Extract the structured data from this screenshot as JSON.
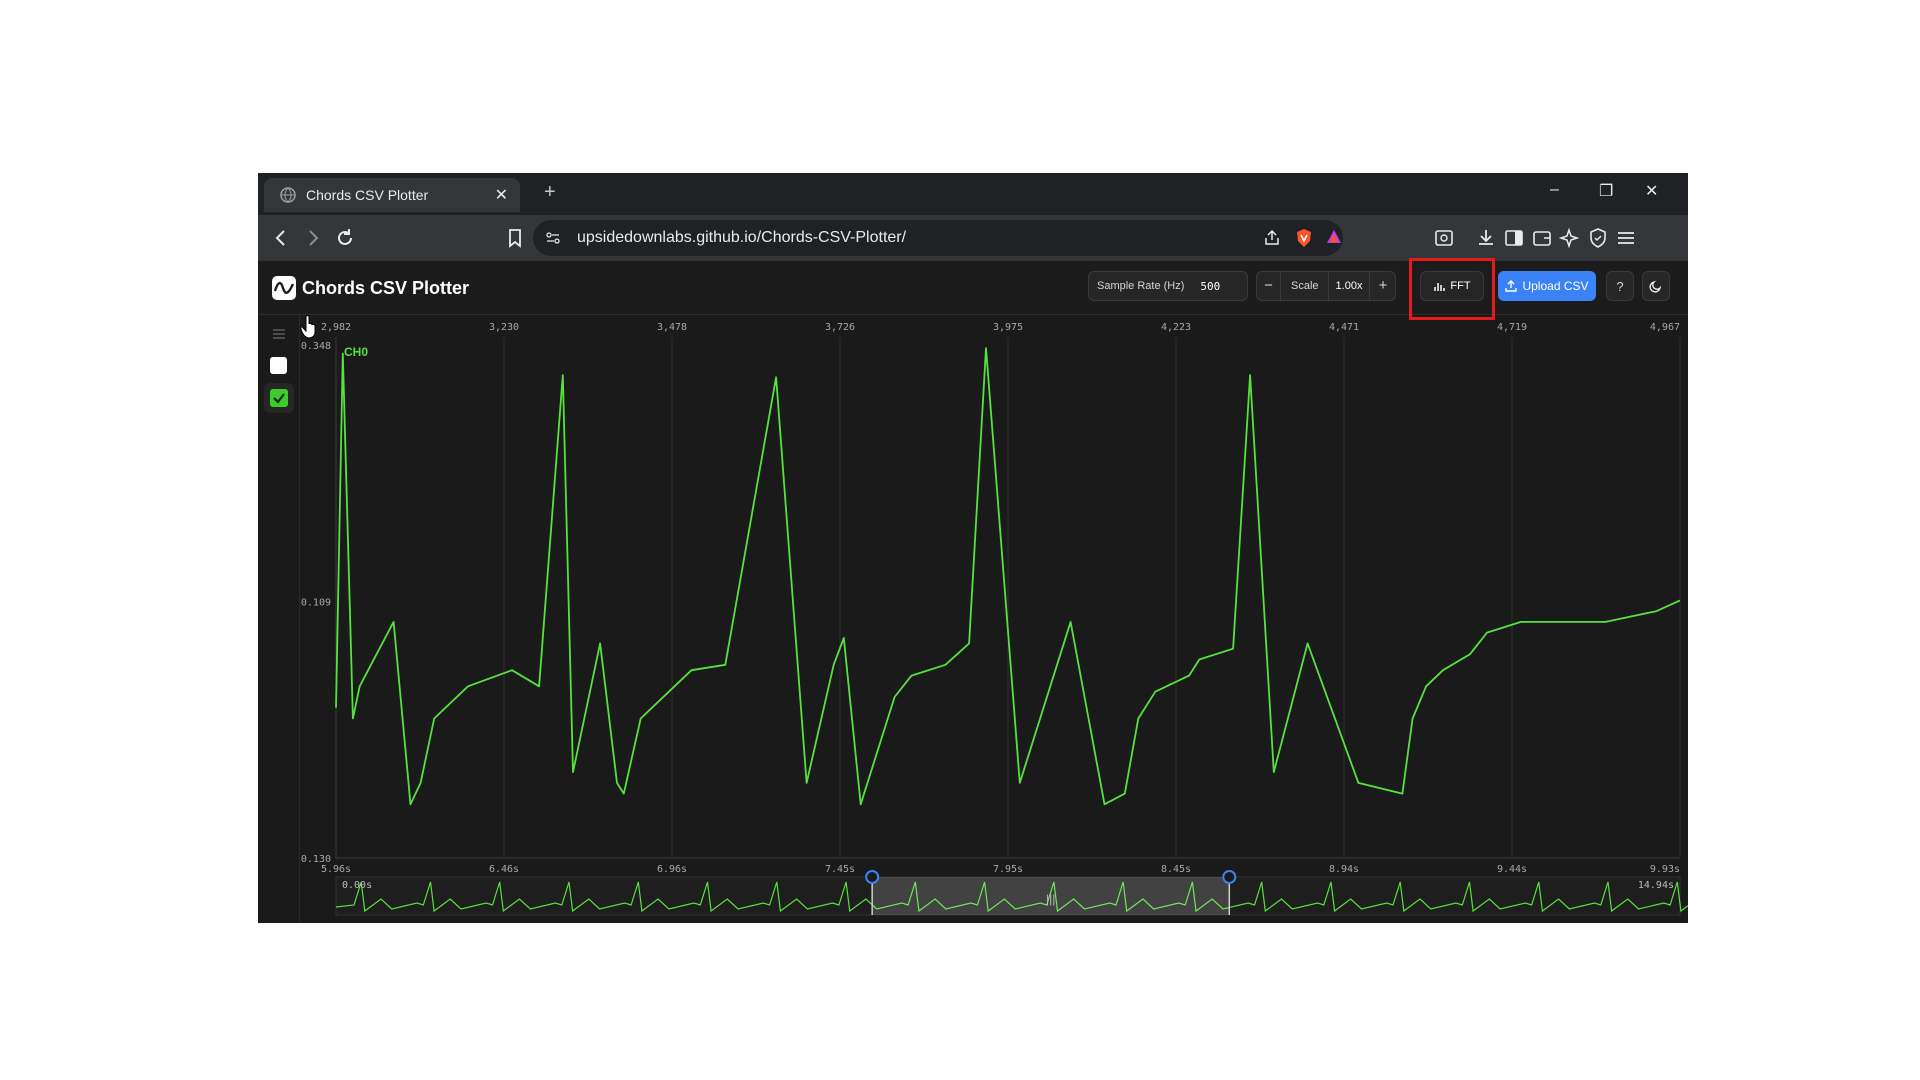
{
  "browser": {
    "tab_title": "Chords CSV Plotter",
    "tab_close": "✕",
    "new_tab": "+",
    "url_host": "upsidedownlabs.github.io",
    "url_path": "/Chords-CSV-Plotter/",
    "window_controls": {
      "minimize": "–",
      "restore": "❐",
      "close": "✕"
    }
  },
  "app": {
    "title": "Chords CSV Plotter",
    "sample_rate_label": "Sample Rate (Hz)",
    "sample_rate_value": "500",
    "scale_minus": "−",
    "scale_label": "Scale",
    "scale_value": "1.00x",
    "scale_plus": "+",
    "fft_label": "FFT",
    "upload_label": "Upload CSV",
    "help_label": "?",
    "channel_label": "CH0",
    "accent_color": "#3b82f6",
    "trace_color": "#56e23c",
    "highlight_color": "#e31b1b"
  },
  "chart_data": {
    "type": "line",
    "x_top_ticks": [
      "2,982",
      "3,230",
      "3,478",
      "3,726",
      "3,975",
      "4,223",
      "4,471",
      "4,719",
      "4,967"
    ],
    "x_bottom_ticks": [
      "5.96s",
      "6.46s",
      "6.96s",
      "7.45s",
      "7.95s",
      "8.45s",
      "8.94s",
      "9.44s",
      "9.93s"
    ],
    "y_ticks": [
      "0.348",
      "0.109",
      "-0.130"
    ],
    "ylim": [
      -0.13,
      0.348
    ],
    "xlim_s": [
      5.96,
      9.93
    ],
    "series": [
      {
        "name": "CH0",
        "x": [
          5.96,
          5.98,
          6.01,
          6.03,
          6.08,
          6.13,
          6.18,
          6.21,
          6.25,
          6.35,
          6.48,
          6.56,
          6.63,
          6.66,
          6.74,
          6.79,
          6.81,
          6.86,
          6.96,
          7.01,
          7.11,
          7.26,
          7.35,
          7.43,
          7.46,
          7.51,
          7.61,
          7.66,
          7.76,
          7.83,
          7.88,
          7.98,
          8.13,
          8.23,
          8.29,
          8.33,
          8.38,
          8.48,
          8.51,
          8.61,
          8.66,
          8.73,
          8.83,
          8.98,
          9.11,
          9.14,
          9.18,
          9.23,
          9.31,
          9.36,
          9.46,
          9.56,
          9.71,
          9.86,
          9.93
        ],
        "values": [
          0.01,
          0.34,
          0.0,
          0.03,
          0.06,
          0.09,
          -0.08,
          -0.06,
          0.0,
          0.03,
          0.045,
          0.03,
          0.32,
          -0.05,
          0.07,
          -0.06,
          -0.07,
          0.0,
          0.03,
          0.045,
          0.05,
          0.318,
          -0.06,
          0.05,
          0.075,
          -0.08,
          0.02,
          0.04,
          0.05,
          0.07,
          0.345,
          -0.06,
          0.09,
          -0.08,
          -0.07,
          0.0,
          0.025,
          0.04,
          0.055,
          0.065,
          0.32,
          -0.05,
          0.07,
          -0.06,
          -0.07,
          0.0,
          0.03,
          0.045,
          0.06,
          0.08,
          0.09,
          0.09,
          0.09,
          0.1,
          0.11
        ]
      }
    ],
    "overview": {
      "start_label": "0.00s",
      "end_label": "14.94s",
      "window_s": [
        5.96,
        9.93
      ],
      "range_s": [
        0,
        14.94
      ]
    },
    "grid": true,
    "legend": "top-left"
  }
}
